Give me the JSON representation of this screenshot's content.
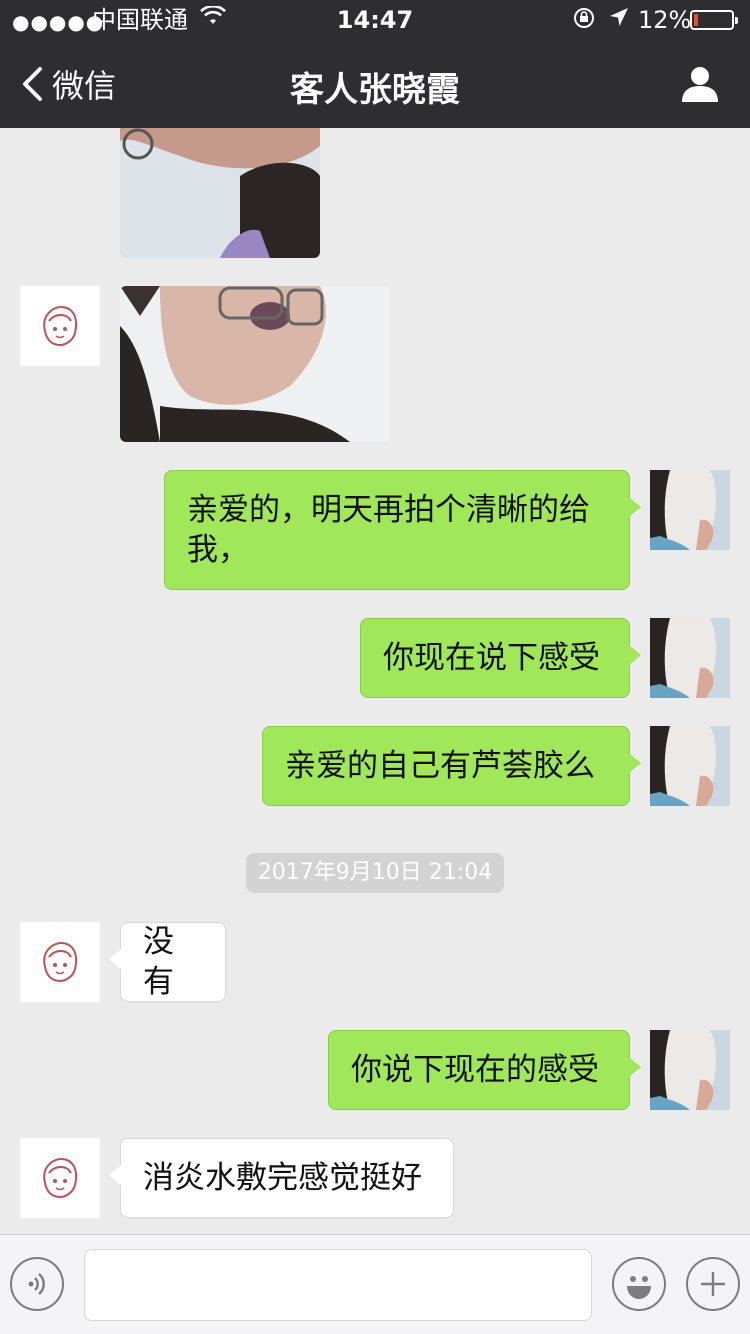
{
  "status_bar": {
    "carrier": "中国联通",
    "time": "14:47",
    "battery_percent": "12%",
    "battery_level": 0.12,
    "signal_dots": "●●●●●"
  },
  "nav": {
    "back_label": "微信",
    "title": "客人张晓霞"
  },
  "messages": [
    {
      "side": "left",
      "type": "image",
      "description_icon": "photo"
    },
    {
      "side": "left",
      "type": "image",
      "description_icon": "photo"
    },
    {
      "side": "right",
      "type": "text",
      "text": "亲爱的，明天再拍个清晰的给我，"
    },
    {
      "side": "right",
      "type": "text",
      "text": "你现在说下感受"
    },
    {
      "side": "right",
      "type": "text",
      "text": "亲爱的自己有芦荟胶么"
    },
    {
      "type": "timestamp",
      "text": "2017年9月10日 21:04"
    },
    {
      "side": "left",
      "type": "text",
      "text": "没有"
    },
    {
      "side": "right",
      "type": "text",
      "text": "你说下现在的感受"
    },
    {
      "side": "left",
      "type": "text",
      "text": "消炎水敷完感觉挺好"
    }
  ],
  "input": {
    "placeholder": ""
  },
  "colors": {
    "nav_bg": "#2e2e30",
    "chat_bg": "#ebebeb",
    "bubble_right": "#a0e75a",
    "bubble_left": "#ffffff",
    "battery_low": "#e74c3c"
  }
}
